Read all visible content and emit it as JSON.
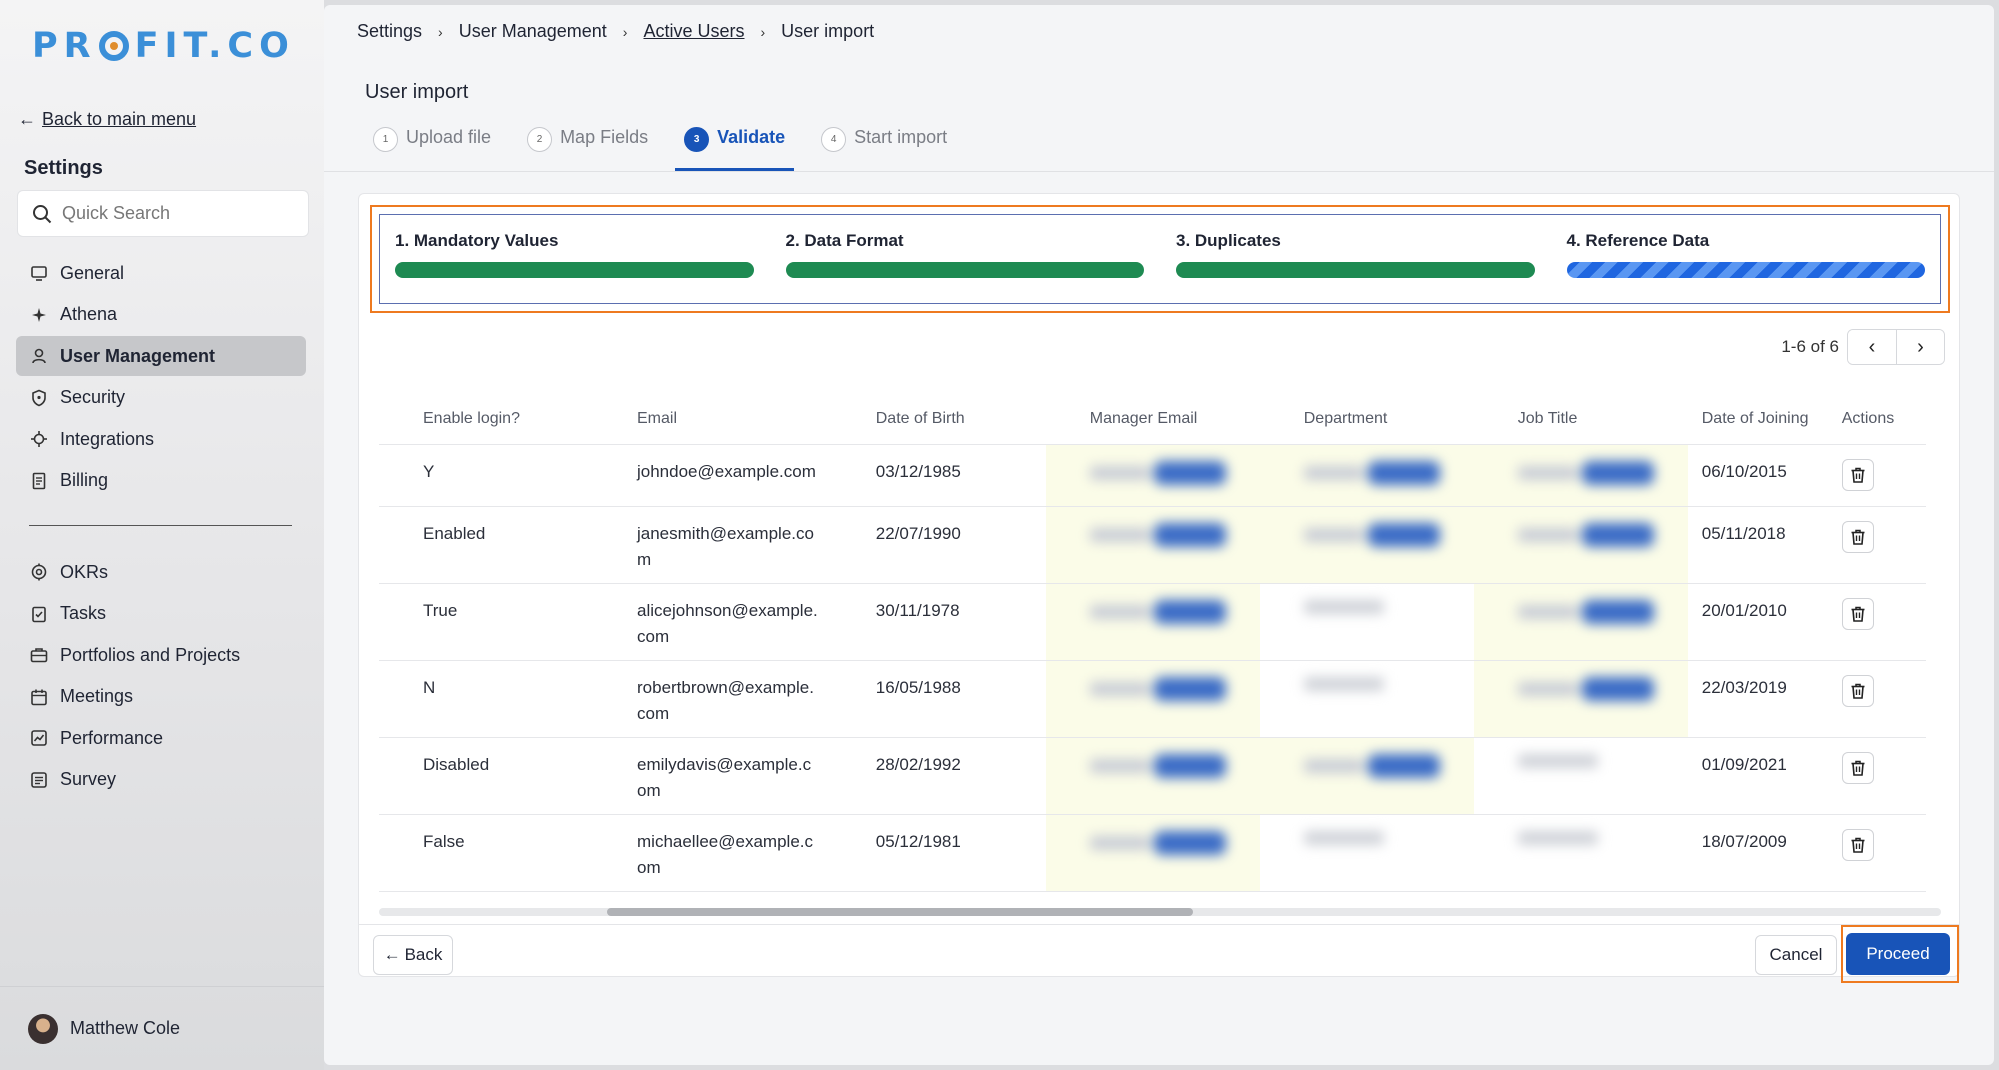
{
  "brand": {
    "logo_text_left": "PR",
    "logo_text_right": "FIT.CO"
  },
  "sidebar": {
    "back_label": "Back to main menu",
    "section_title": "Settings",
    "search_placeholder": "Quick Search",
    "items": [
      {
        "label": "General",
        "icon": "monitor-icon"
      },
      {
        "label": "Athena",
        "icon": "sparkle-icon"
      },
      {
        "label": "User Management",
        "icon": "user-icon",
        "active": true
      },
      {
        "label": "Security",
        "icon": "shield-icon"
      },
      {
        "label": "Integrations",
        "icon": "plug-icon"
      },
      {
        "label": "Billing",
        "icon": "receipt-icon"
      }
    ],
    "items2": [
      {
        "label": "OKRs",
        "icon": "target-icon"
      },
      {
        "label": "Tasks",
        "icon": "clipboard-check-icon"
      },
      {
        "label": "Portfolios and Projects",
        "icon": "briefcase-icon"
      },
      {
        "label": "Meetings",
        "icon": "calendar-icon"
      },
      {
        "label": "Performance",
        "icon": "chart-line-icon"
      },
      {
        "label": "Survey",
        "icon": "list-icon"
      }
    ],
    "user_name": "Matthew Cole"
  },
  "breadcrumb": [
    "Settings",
    "User Management",
    "Active Users",
    "User import"
  ],
  "page_title": "User import",
  "steps": [
    {
      "num": "1",
      "label": "Upload file"
    },
    {
      "num": "2",
      "label": "Map Fields"
    },
    {
      "num": "3",
      "label": "Validate",
      "active": true
    },
    {
      "num": "4",
      "label": "Start import"
    }
  ],
  "validation": [
    {
      "label": "1. Mandatory Values",
      "status": "complete"
    },
    {
      "label": "2. Data Format",
      "status": "complete"
    },
    {
      "label": "3. Duplicates",
      "status": "complete"
    },
    {
      "label": "4. Reference Data",
      "status": "in-progress"
    }
  ],
  "pager": {
    "text": "1-6 of 6"
  },
  "table": {
    "columns": [
      "Enable login?",
      "Email",
      "Date of Birth",
      "Manager Email",
      "Department",
      "Job Title",
      "Date of Joining",
      "Actions"
    ],
    "rows": [
      {
        "login": "Y",
        "email": "johndoe@example.com",
        "dob": "03/12/1985",
        "doj": "06/10/2015"
      },
      {
        "login": "Enabled",
        "email": "janesmith@example.co\nm",
        "dob": "22/07/1990",
        "doj": "05/11/2018"
      },
      {
        "login": "True",
        "email": "alicejohnson@example.\ncom",
        "dob": "30/11/1978",
        "doj": "20/01/2010"
      },
      {
        "login": "N",
        "email": "robertbrown@example.\ncom",
        "dob": "16/05/1988",
        "doj": "22/03/2019"
      },
      {
        "login": "Disabled",
        "email": "emilydavis@example.c\nom",
        "dob": "28/02/1992",
        "doj": "01/09/2021"
      },
      {
        "login": "False",
        "email": "michaellee@example.c\nom",
        "dob": "05/12/1981",
        "doj": "18/07/2009"
      }
    ]
  },
  "footer": {
    "back_label": "Back",
    "cancel_label": "Cancel",
    "proceed_label": "Proceed"
  },
  "colors": {
    "accent": "#1854b8",
    "success": "#1e8a52",
    "highlight": "#ee7a20"
  }
}
